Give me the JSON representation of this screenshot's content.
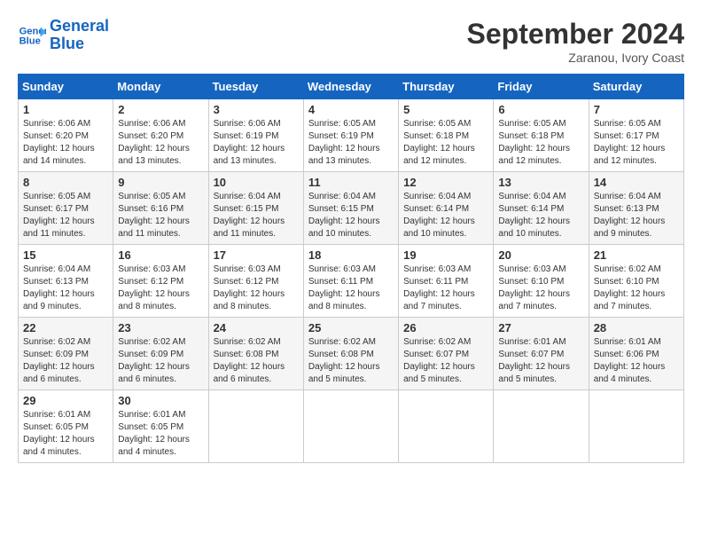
{
  "logo": {
    "line1": "General",
    "line2": "Blue"
  },
  "title": "September 2024",
  "subtitle": "Zaranou, Ivory Coast",
  "headers": [
    "Sunday",
    "Monday",
    "Tuesday",
    "Wednesday",
    "Thursday",
    "Friday",
    "Saturday"
  ],
  "weeks": [
    [
      {
        "day": "1",
        "sunrise": "6:06 AM",
        "sunset": "6:20 PM",
        "daylight": "12 hours and 14 minutes."
      },
      {
        "day": "2",
        "sunrise": "6:06 AM",
        "sunset": "6:20 PM",
        "daylight": "12 hours and 13 minutes."
      },
      {
        "day": "3",
        "sunrise": "6:06 AM",
        "sunset": "6:19 PM",
        "daylight": "12 hours and 13 minutes."
      },
      {
        "day": "4",
        "sunrise": "6:05 AM",
        "sunset": "6:19 PM",
        "daylight": "12 hours and 13 minutes."
      },
      {
        "day": "5",
        "sunrise": "6:05 AM",
        "sunset": "6:18 PM",
        "daylight": "12 hours and 12 minutes."
      },
      {
        "day": "6",
        "sunrise": "6:05 AM",
        "sunset": "6:18 PM",
        "daylight": "12 hours and 12 minutes."
      },
      {
        "day": "7",
        "sunrise": "6:05 AM",
        "sunset": "6:17 PM",
        "daylight": "12 hours and 12 minutes."
      }
    ],
    [
      {
        "day": "8",
        "sunrise": "6:05 AM",
        "sunset": "6:17 PM",
        "daylight": "12 hours and 11 minutes."
      },
      {
        "day": "9",
        "sunrise": "6:05 AM",
        "sunset": "6:16 PM",
        "daylight": "12 hours and 11 minutes."
      },
      {
        "day": "10",
        "sunrise": "6:04 AM",
        "sunset": "6:15 PM",
        "daylight": "12 hours and 11 minutes."
      },
      {
        "day": "11",
        "sunrise": "6:04 AM",
        "sunset": "6:15 PM",
        "daylight": "12 hours and 10 minutes."
      },
      {
        "day": "12",
        "sunrise": "6:04 AM",
        "sunset": "6:14 PM",
        "daylight": "12 hours and 10 minutes."
      },
      {
        "day": "13",
        "sunrise": "6:04 AM",
        "sunset": "6:14 PM",
        "daylight": "12 hours and 10 minutes."
      },
      {
        "day": "14",
        "sunrise": "6:04 AM",
        "sunset": "6:13 PM",
        "daylight": "12 hours and 9 minutes."
      }
    ],
    [
      {
        "day": "15",
        "sunrise": "6:04 AM",
        "sunset": "6:13 PM",
        "daylight": "12 hours and 9 minutes."
      },
      {
        "day": "16",
        "sunrise": "6:03 AM",
        "sunset": "6:12 PM",
        "daylight": "12 hours and 8 minutes."
      },
      {
        "day": "17",
        "sunrise": "6:03 AM",
        "sunset": "6:12 PM",
        "daylight": "12 hours and 8 minutes."
      },
      {
        "day": "18",
        "sunrise": "6:03 AM",
        "sunset": "6:11 PM",
        "daylight": "12 hours and 8 minutes."
      },
      {
        "day": "19",
        "sunrise": "6:03 AM",
        "sunset": "6:11 PM",
        "daylight": "12 hours and 7 minutes."
      },
      {
        "day": "20",
        "sunrise": "6:03 AM",
        "sunset": "6:10 PM",
        "daylight": "12 hours and 7 minutes."
      },
      {
        "day": "21",
        "sunrise": "6:02 AM",
        "sunset": "6:10 PM",
        "daylight": "12 hours and 7 minutes."
      }
    ],
    [
      {
        "day": "22",
        "sunrise": "6:02 AM",
        "sunset": "6:09 PM",
        "daylight": "12 hours and 6 minutes."
      },
      {
        "day": "23",
        "sunrise": "6:02 AM",
        "sunset": "6:09 PM",
        "daylight": "12 hours and 6 minutes."
      },
      {
        "day": "24",
        "sunrise": "6:02 AM",
        "sunset": "6:08 PM",
        "daylight": "12 hours and 6 minutes."
      },
      {
        "day": "25",
        "sunrise": "6:02 AM",
        "sunset": "6:08 PM",
        "daylight": "12 hours and 5 minutes."
      },
      {
        "day": "26",
        "sunrise": "6:02 AM",
        "sunset": "6:07 PM",
        "daylight": "12 hours and 5 minutes."
      },
      {
        "day": "27",
        "sunrise": "6:01 AM",
        "sunset": "6:07 PM",
        "daylight": "12 hours and 5 minutes."
      },
      {
        "day": "28",
        "sunrise": "6:01 AM",
        "sunset": "6:06 PM",
        "daylight": "12 hours and 4 minutes."
      }
    ],
    [
      {
        "day": "29",
        "sunrise": "6:01 AM",
        "sunset": "6:05 PM",
        "daylight": "12 hours and 4 minutes."
      },
      {
        "day": "30",
        "sunrise": "6:01 AM",
        "sunset": "6:05 PM",
        "daylight": "12 hours and 4 minutes."
      },
      null,
      null,
      null,
      null,
      null
    ]
  ]
}
